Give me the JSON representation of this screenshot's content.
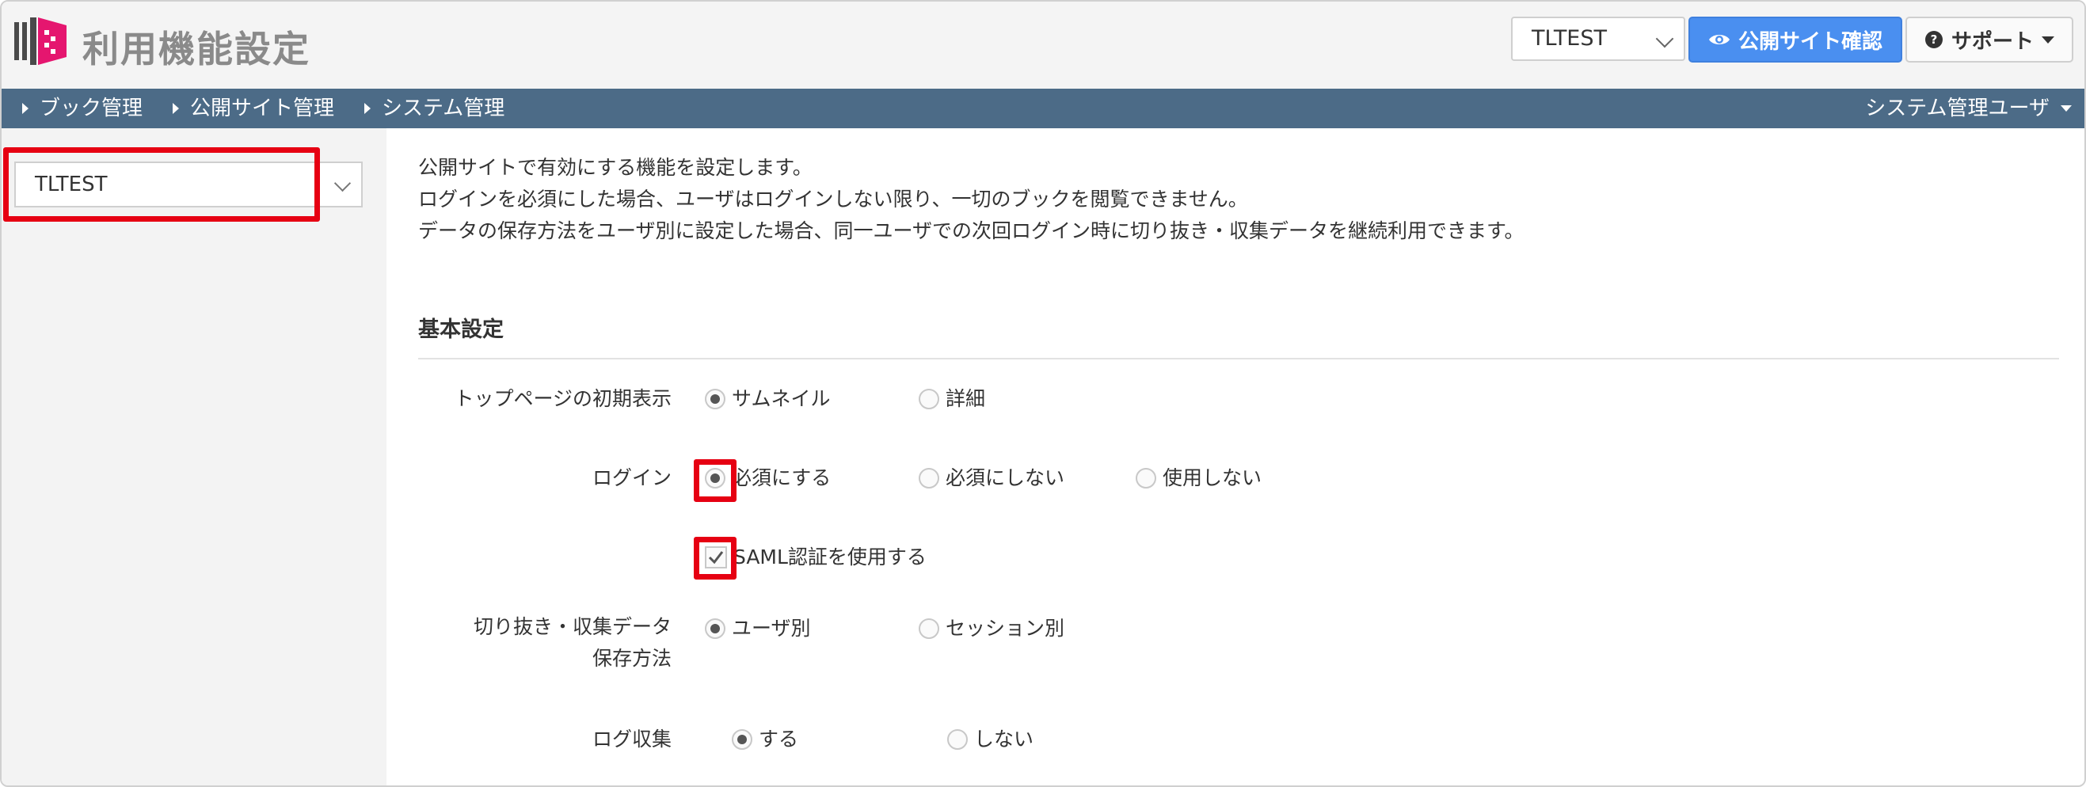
{
  "header": {
    "title": "利用機能設定",
    "tenant_select_value": "TLTEST",
    "preview_button": "公開サイト確認",
    "support_button": "サポート"
  },
  "nav": {
    "items": [
      "ブック管理",
      "公開サイト管理",
      "システム管理"
    ],
    "user_menu": "システム管理ユーザ"
  },
  "sidebar": {
    "tenant_select_value": "TLTEST"
  },
  "main": {
    "intro": [
      "公開サイトで有効にする機能を設定します。",
      "ログインを必須にした場合、ユーザはログインしない限り、一切のブックを閲覧できません。",
      "データの保存方法をユーザ別に設定した場合、同一ユーザでの次回ログイン時に切り抜き・収集データを継続利用できます。"
    ],
    "section_title": "基本設定",
    "settings": {
      "top_page": {
        "label": "トップページの初期表示",
        "options": [
          "サムネイル",
          "詳細"
        ],
        "selected": "サムネイル"
      },
      "login": {
        "label": "ログイン",
        "options": [
          "必須にする",
          "必須にしない",
          "使用しない"
        ],
        "selected": "必須にする"
      },
      "saml": {
        "label": "SAML認証を使用する",
        "checked": true
      },
      "clip_storage": {
        "label_line1": "切り抜き・収集データ",
        "label_line2": "保存方法",
        "options": [
          "ユーザ別",
          "セッション別"
        ],
        "selected": "ユーザ別"
      },
      "log_collection": {
        "label": "ログ収集",
        "options": [
          "する",
          "しない"
        ],
        "selected": "する"
      }
    }
  },
  "colors": {
    "accent": "#4a8ff0",
    "nav": "#4c6b87",
    "highlight": "#e60012",
    "logo": "#e5166f"
  }
}
